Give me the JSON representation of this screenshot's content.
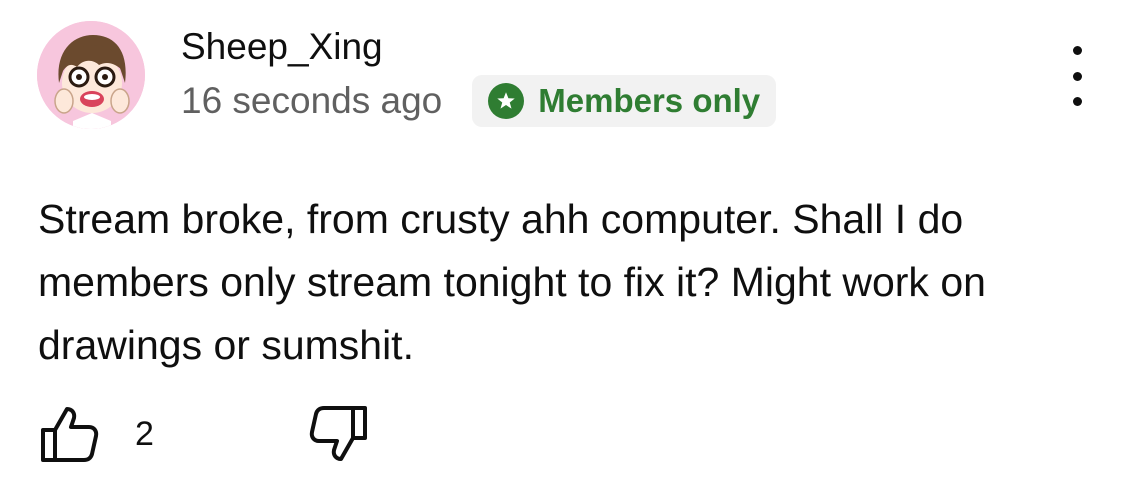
{
  "comment": {
    "author": "Sheep_Xing",
    "timestamp": "16 seconds ago",
    "badge": {
      "label": "Members only",
      "icon": "star-icon",
      "color": "#2f7d32"
    },
    "text": "Stream broke, from crusty ahh computer. Shall I do members only stream tonight to fix it? Might work on drawings or sumshit.",
    "like_count": "2",
    "icons": {
      "more": "more-vertical-icon",
      "like": "thumbs-up-icon",
      "dislike": "thumbs-down-icon"
    }
  }
}
